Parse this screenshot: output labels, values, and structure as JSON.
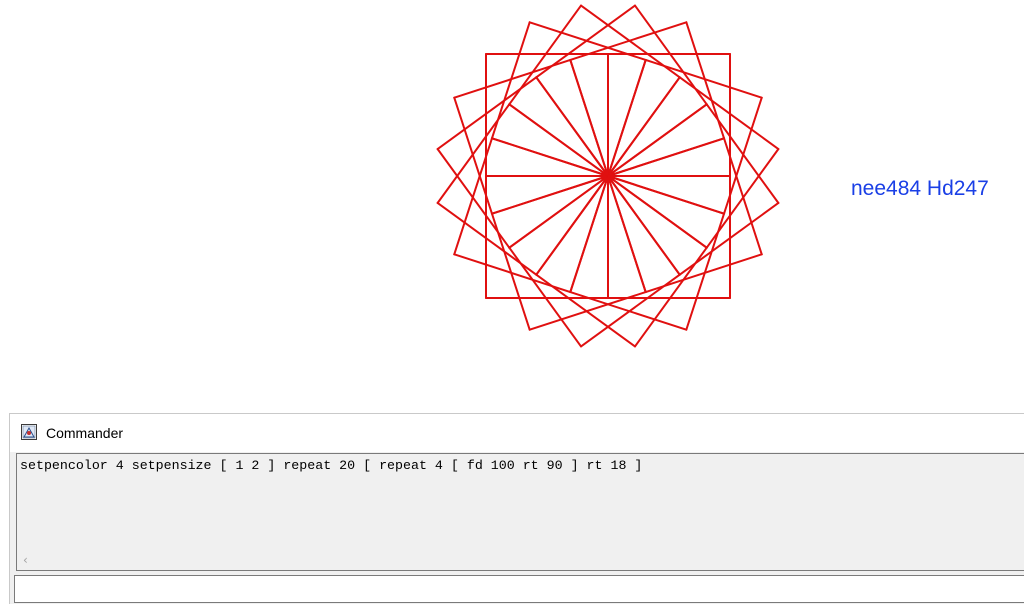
{
  "canvas": {
    "pen_color": "#e01010",
    "repeat_outer": 20,
    "repeat_inner": 4,
    "side_length": 100,
    "inner_turn_deg": 90,
    "outer_turn_deg": 18
  },
  "overlay": {
    "label": "nee484 Hd247",
    "color": "#1a3fe6"
  },
  "commander": {
    "title": "Commander",
    "history": "setpencolor 4 setpensize [ 1 2 ] repeat 20 [ repeat 4 [ fd 100 rt 90 ] rt 18 ]",
    "input_value": "",
    "scroll_left_icon": "‹"
  },
  "icons": {
    "app_icon": "logo-app-icon",
    "scroll_left": "chevron-left-icon"
  }
}
